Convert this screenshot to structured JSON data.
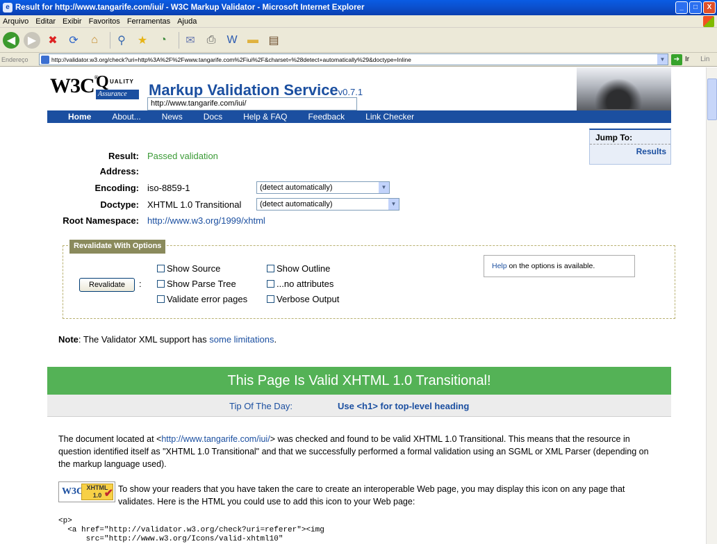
{
  "window": {
    "title": "Result for http://www.tangarife.com/iui/ - W3C Markup Validator - Microsoft Internet Explorer",
    "buttons": [
      "_",
      "□",
      "X"
    ]
  },
  "menu": [
    "Arquivo",
    "Editar",
    "Exibir",
    "Favoritos",
    "Ferramentas",
    "Ajuda"
  ],
  "address_bar": {
    "label": "Endereço",
    "url": "http://validator.w3.org/check?uri=http%3A%2F%2Fwww.tangarife.com%2Fiui%2F&charset=%28detect+automatically%29&doctype=Inline",
    "go_label": "Ir",
    "links_label": "Lin"
  },
  "banner": {
    "w3c": "W3C",
    "qa_q": "Q",
    "qa_uality": "UALITY",
    "qa_assurance": "Assurance",
    "service": "Markup Validation Service",
    "version": "v0.7.1"
  },
  "nav": [
    "Home",
    "About...",
    "News",
    "Docs",
    "Help & FAQ",
    "Feedback",
    "Link Checker"
  ],
  "jump_to": {
    "title": "Jump To:",
    "link": "Results"
  },
  "result": {
    "result_label": "Result:",
    "result_value": "Passed validation",
    "address_label": "Address:",
    "address_value": "http://www.tangarife.com/iui/",
    "encoding_label": "Encoding:",
    "encoding_value": "iso-8859-1",
    "encoding_select": "(detect automatically)",
    "doctype_label": "Doctype:",
    "doctype_value": "XHTML 1.0 Transitional",
    "doctype_select": "(detect automatically)",
    "ns_label": "Root Namespace:",
    "ns_value": "http://www.w3.org/1999/xhtml"
  },
  "revalidate": {
    "legend": "Revalidate With Options",
    "button": "Revalidate",
    "colon": ":",
    "options": {
      "show_source": "Show Source",
      "show_outline": "Show Outline",
      "show_parse_tree": "Show Parse Tree",
      "no_attributes": "...no attributes",
      "validate_error_pages": "Validate error pages",
      "verbose_output": "Verbose Output"
    },
    "help_link": "Help",
    "help_text": " on the options is available."
  },
  "note": {
    "label": "Note",
    "text": ": The Validator XML support has ",
    "link": "some limitations",
    "end": "."
  },
  "valid_banner": "This Page Is Valid XHTML 1.0 Transitional!",
  "tip": {
    "label": "Tip Of The Day:",
    "text": "Use <h1> for top-level heading"
  },
  "paragraph1": {
    "pre": "The document located at <",
    "link": "http://www.tangarife.com/iui/",
    "post": "> was checked and found to be valid XHTML 1.0 Transitional. This means that the resource in question identified itself as \"XHTML 1.0 Transitional\" and that we successfully performed a formal validation using an SGML or XML Parser (depending on the markup language used)."
  },
  "badge": {
    "w3c": "W3C",
    "xhtml": "XHTML",
    "ver": "1.0"
  },
  "paragraph2": "To show your readers that you have taken the care to create an interoperable Web page, you may display this icon on any page that validates. Here is the HTML you could use to add this icon to your Web page:",
  "code": "<p>\n  <a href=\"http://validator.w3.org/check?uri=referer\"><img\n      src=\"http://www.w3.org/Icons/valid-xhtml10\""
}
